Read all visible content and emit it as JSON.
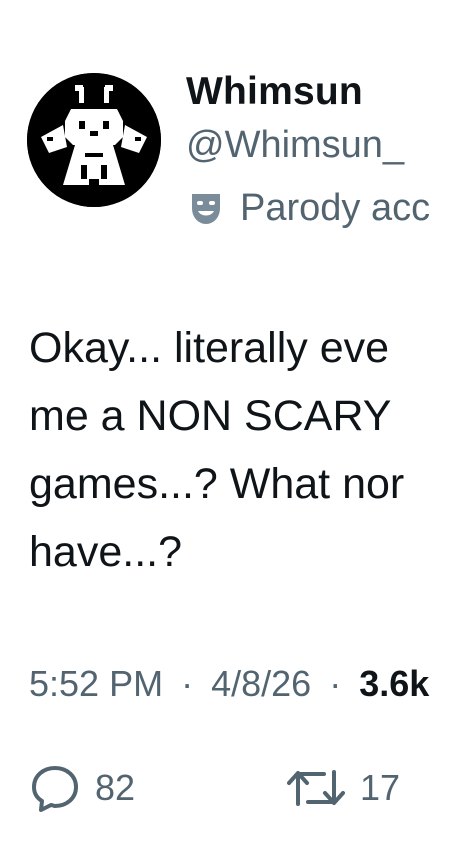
{
  "author": {
    "display_name": "Whimsun",
    "handle": "@Whimsun_",
    "label": "Parody acc",
    "avatar_icon": "whimsun-sprite-avatar",
    "label_icon": "theater-masks-icon"
  },
  "tweet": {
    "lines": [
      "Okay... literally eve",
      "me a NON SCARY",
      "games...? What nor",
      "have...?"
    ]
  },
  "meta": {
    "time": "5:52 PM",
    "date": "4/8/26",
    "views": "3.6k",
    "separator": "·"
  },
  "actions": {
    "replies": "82",
    "retweets": "17"
  },
  "colors": {
    "text": "#0f1419",
    "secondary": "#536471",
    "background": "#ffffff"
  }
}
